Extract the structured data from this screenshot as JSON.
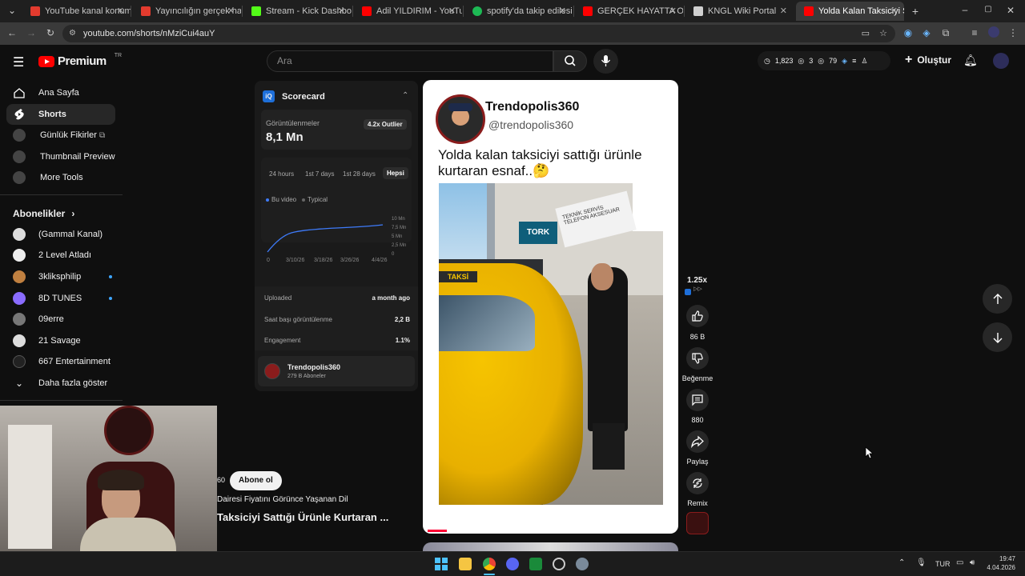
{
  "browser": {
    "tabs": [
      {
        "title": "YouTube kanal konumlarını",
        "color": "#e33b2e"
      },
      {
        "title": "Yayıncılığın gerçek hazırlığı",
        "color": "#e33b2e"
      },
      {
        "title": "Stream - Kick Dashboard",
        "color": "#53fc18"
      },
      {
        "title": "Adil YILDIRIM - YouTube",
        "color": "#ff0000"
      },
      {
        "title": "spotify'da takip edilesi po",
        "color": "#1db954"
      },
      {
        "title": "GERÇEK HAYATTA OYUN",
        "color": "#ff0000"
      },
      {
        "title": "KNGL Wiki Portal",
        "color": "#cfcfcf"
      },
      {
        "title": "Yolda Kalan Taksiciyi S",
        "color": "#ff0000"
      }
    ],
    "url": "youtube.com/shorts/nMziCui4auY"
  },
  "youtube": {
    "brand": "Premium",
    "region": "TR",
    "search_placeholder": "Ara",
    "header_stats": {
      "a": "1,823",
      "b": "3",
      "c": "79"
    },
    "create_label": "Oluştur"
  },
  "sidebar": {
    "main": [
      {
        "label": "Ana Sayfa"
      },
      {
        "label": "Shorts"
      },
      {
        "label": "Günlük Fikirler"
      },
      {
        "label": "Thumbnail Preview"
      },
      {
        "label": "More Tools"
      }
    ],
    "subscriptions_title": "Abonelikler",
    "subscriptions": [
      {
        "label": "(Gammal Kanal)",
        "color": "#ddd"
      },
      {
        "label": "2 Level Atladı",
        "color": "#eee"
      },
      {
        "label": "3kliksphilip",
        "color": "#c08040"
      },
      {
        "label": "8D TUNES",
        "color": "#8a6cff"
      },
      {
        "label": "09erre",
        "color": "#777"
      },
      {
        "label": "21 Savage",
        "color": "#ddd"
      },
      {
        "label": "667 Entertainment",
        "color": "#222"
      }
    ],
    "show_more": "Daha fazla göster"
  },
  "scorecard": {
    "title": "Scorecard",
    "views_label": "Görüntülenmeler",
    "views_value": "8,1 Mn",
    "outlier": "4.2x Outlier",
    "ranges": [
      "24 hours",
      "1st 7 days",
      "1st 28 days",
      "Hepsi"
    ],
    "legend": {
      "this": "Bu video",
      "typical": "Typical"
    },
    "y_ticks": [
      "10 Mn",
      "7,5 Mn",
      "5 Mn",
      "2,5 Mn",
      "0"
    ],
    "x_ticks": [
      "0",
      "3/10/26",
      "3/18/26",
      "3/26/26",
      "4/4/26"
    ],
    "rows": [
      {
        "label": "Uploaded",
        "value": "a month ago"
      },
      {
        "label": "Saat başı görüntülenme",
        "value": "2,2 B"
      },
      {
        "label": "Engagement",
        "value": "1.1%"
      }
    ],
    "channel_name": "Trendopolis360",
    "channel_subs": "279 B Aboneler"
  },
  "post": {
    "name": "Trendopolis360",
    "handle": "@trendopolis360",
    "text": "Yolda kalan taksiciyi sattığı ürünle kurtaran esnaf..🤔",
    "sign_taksi": "TAKSİ",
    "sign_shop": "TEKNİK SERVİS TELEFON AKSESUAR",
    "sign_tork": "TORK"
  },
  "actions": {
    "speed": "1.25x",
    "likes": "86 B",
    "dislike": "Beğenme",
    "comments": "880",
    "share": "Paylaş",
    "remix": "Remix"
  },
  "overlay": {
    "subscribe": "Abone ol",
    "line1": "Dairesi Fiyatını Görünce Yaşanan Dil",
    "line2": "Taksiciyi Sattığı Ürünle Kurtaran ...",
    "prefix": "60"
  },
  "taskbar": {
    "lang": "TUR",
    "time": "19:47",
    "date": "4.04.2026"
  }
}
